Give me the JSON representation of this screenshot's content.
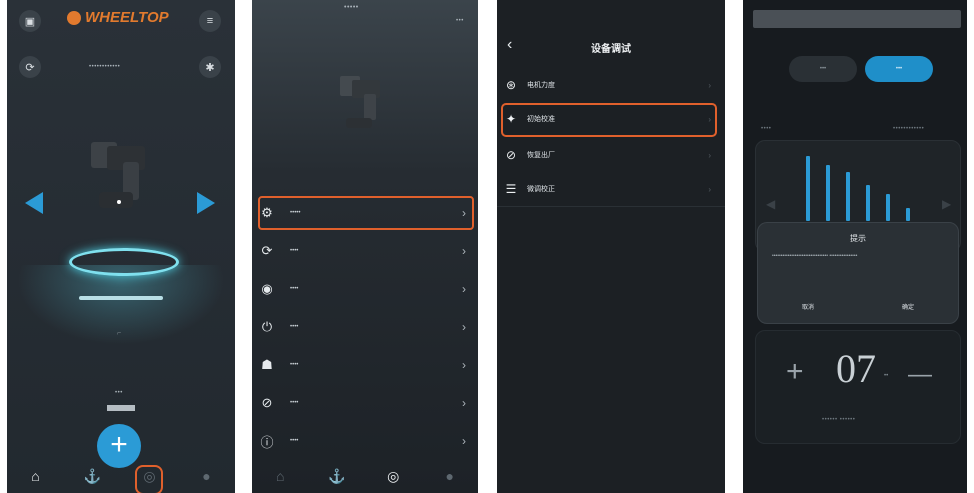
{
  "colors": {
    "accent": "#2b9bd6",
    "highlight": "#e0602c",
    "brand": "#e27a2e"
  },
  "screen1": {
    "logo_text": "WHEELTOP",
    "logo_sub": "——",
    "device_serial": "••••••••••••",
    "page_label": "•••",
    "add_symbol": "+",
    "icons": [
      "save-icon",
      "menu-icon",
      "refresh-icon",
      "bluetooth-icon",
      "arrow-left-icon",
      "arrow-right-icon",
      "plus-icon"
    ],
    "nav": [
      "home",
      "tools",
      "device",
      "profile"
    ]
  },
  "screen2": {
    "title": "•••••",
    "top_right": "•••",
    "menu": [
      {
        "icon": "calibrate-icon",
        "glyph": "⚙",
        "label": "•••••",
        "chevron": "›"
      },
      {
        "icon": "motor-icon",
        "glyph": "⟳",
        "label": "••••",
        "chevron": "›"
      },
      {
        "icon": "mode-icon",
        "glyph": "◉",
        "label": "••••",
        "chevron": "›"
      },
      {
        "icon": "power-icon",
        "glyph": "⏻",
        "label": "••••",
        "chevron": "›"
      },
      {
        "icon": "firmware-icon",
        "glyph": "☗",
        "label": "••••",
        "chevron": "›"
      },
      {
        "icon": "help-icon",
        "glyph": "⊘",
        "label": "••••",
        "chevron": "›"
      },
      {
        "icon": "about-icon",
        "glyph": "ⓘ",
        "label": "••••",
        "chevron": "›"
      }
    ],
    "nav": [
      "home",
      "tools",
      "device",
      "profile"
    ]
  },
  "screen3": {
    "title": "设备调试",
    "back": "‹",
    "menu": [
      {
        "icon": "motor-strength-icon",
        "glyph": "⊛",
        "label": "电机力度",
        "chevron": "›"
      },
      {
        "icon": "init-calibrate-icon",
        "glyph": "✦",
        "label": "初始校准",
        "chevron": "›"
      },
      {
        "icon": "restore-icon",
        "glyph": "⊘",
        "label": "恢复出厂",
        "chevron": "›"
      },
      {
        "icon": "fine-tune-icon",
        "glyph": "☰",
        "label": "微调校正",
        "chevron": "›"
      }
    ]
  },
  "screen4": {
    "tab_left": "•••",
    "tab_right": "•••",
    "chart_left_label": "••••",
    "chart_right_label": "••••••••••••",
    "chart_data": {
      "type": "bar",
      "values": [
        72,
        62,
        54,
        40,
        30,
        14
      ]
    },
    "dialog": {
      "title": "提示",
      "body": "•••••••••••••••••••••••••••••••• ••••••••••••••••",
      "cancel": "取消",
      "confirm": "确定"
    },
    "stepper": {
      "plus": "+",
      "value": "07",
      "unit": "••",
      "minus": "—",
      "caption": "••••••  ••••••"
    }
  }
}
